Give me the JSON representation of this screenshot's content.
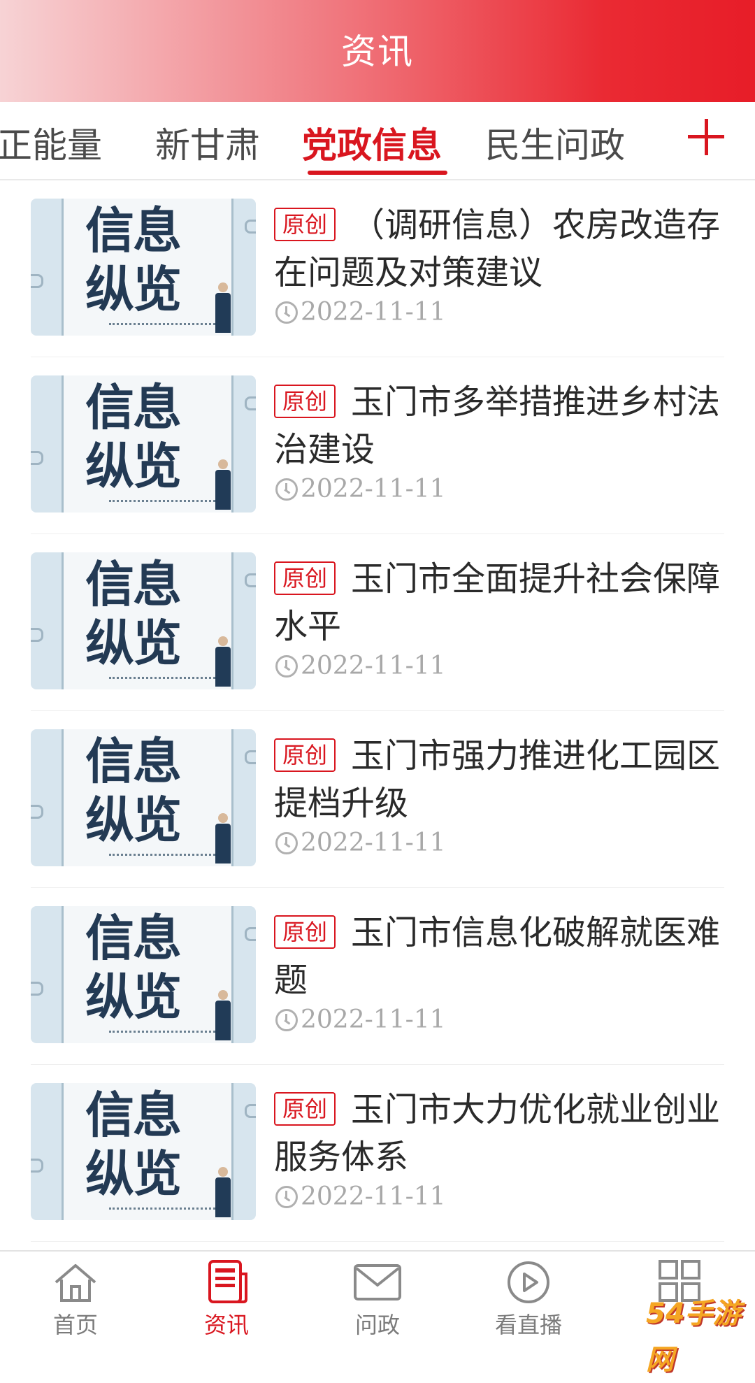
{
  "header": {
    "title": "资讯"
  },
  "tabs": [
    {
      "label": "正能量",
      "active": false
    },
    {
      "label": "新甘肃",
      "active": false
    },
    {
      "label": "党政信息",
      "active": true
    },
    {
      "label": "民生问政",
      "active": false
    }
  ],
  "add_tab_icon": "plus-icon",
  "thumbnail": {
    "line1": "信息",
    "line2": "纵览"
  },
  "articles": [
    {
      "badge": "原创",
      "title": "（调研信息）农房改造存在问题及对策建议",
      "date": "2022-11-11"
    },
    {
      "badge": "原创",
      "title": "玉门市多举措推进乡村法治建设",
      "date": "2022-11-11"
    },
    {
      "badge": "原创",
      "title": "玉门市全面提升社会保障水平",
      "date": "2022-11-11"
    },
    {
      "badge": "原创",
      "title": "玉门市强力推进化工园区提档升级",
      "date": "2022-11-11"
    },
    {
      "badge": "原创",
      "title": "玉门市信息化破解就医难题",
      "date": "2022-11-11"
    },
    {
      "badge": "原创",
      "title": "玉门市大力优化就业创业服务体系",
      "date": "2022-11-11"
    }
  ],
  "bottom_nav": [
    {
      "label": "首页",
      "icon": "home-icon",
      "active": false
    },
    {
      "label": "资讯",
      "icon": "news-icon",
      "active": true
    },
    {
      "label": "问政",
      "icon": "mail-icon",
      "active": false
    },
    {
      "label": "看直播",
      "icon": "play-icon",
      "active": false
    },
    {
      "label": "",
      "icon": "grid-icon",
      "active": false
    }
  ],
  "watermark": "54手游网",
  "colors": {
    "accent": "#d9161f",
    "header_end": "#e71d28"
  }
}
